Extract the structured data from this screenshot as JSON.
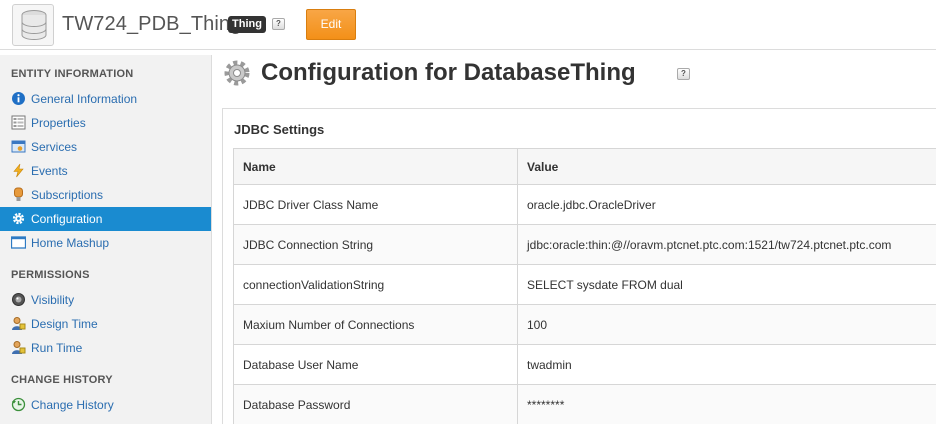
{
  "header": {
    "entity_name": "TW724_PDB_Thing",
    "type_badge": "Thing",
    "help": "?",
    "edit_label": "Edit"
  },
  "sidebar": {
    "sections": [
      {
        "heading": "ENTITY INFORMATION",
        "items": [
          {
            "label": "General Information",
            "icon": "info-icon"
          },
          {
            "label": "Properties",
            "icon": "properties-icon"
          },
          {
            "label": "Services",
            "icon": "services-icon"
          },
          {
            "label": "Events",
            "icon": "lightning-icon"
          },
          {
            "label": "Subscriptions",
            "icon": "subscriptions-icon"
          },
          {
            "label": "Configuration",
            "icon": "gear-icon",
            "active": true
          },
          {
            "label": "Home Mashup",
            "icon": "mashup-icon"
          }
        ]
      },
      {
        "heading": "PERMISSIONS",
        "items": [
          {
            "label": "Visibility",
            "icon": "visibility-icon"
          },
          {
            "label": "Design Time",
            "icon": "design-time-icon"
          },
          {
            "label": "Run Time",
            "icon": "run-time-icon"
          }
        ]
      },
      {
        "heading": "CHANGE HISTORY",
        "items": [
          {
            "label": "Change History",
            "icon": "change-history-icon"
          }
        ]
      }
    ]
  },
  "main": {
    "title": "Configuration for DatabaseThing",
    "help": "?",
    "panel_title": "JDBC Settings",
    "columns": [
      "Name",
      "Value"
    ],
    "rows": [
      {
        "name": "JDBC Driver Class Name",
        "value": "oracle.jdbc.OracleDriver"
      },
      {
        "name": "JDBC Connection String",
        "value": "jdbc:oracle:thin:@//oravm.ptcnet.ptc.com:1521/tw724.ptcnet.ptc.com"
      },
      {
        "name": "connectionValidationString",
        "value": "SELECT sysdate FROM dual"
      },
      {
        "name": "Maxium Number of Connections",
        "value": "100"
      },
      {
        "name": "Database User Name",
        "value": "twadmin"
      },
      {
        "name": "Database Password",
        "value": "********"
      }
    ]
  },
  "colors": {
    "accent": "#1a8bd0",
    "link": "#2a6db0",
    "edit_button": "#f39018",
    "badge": "#333333"
  }
}
